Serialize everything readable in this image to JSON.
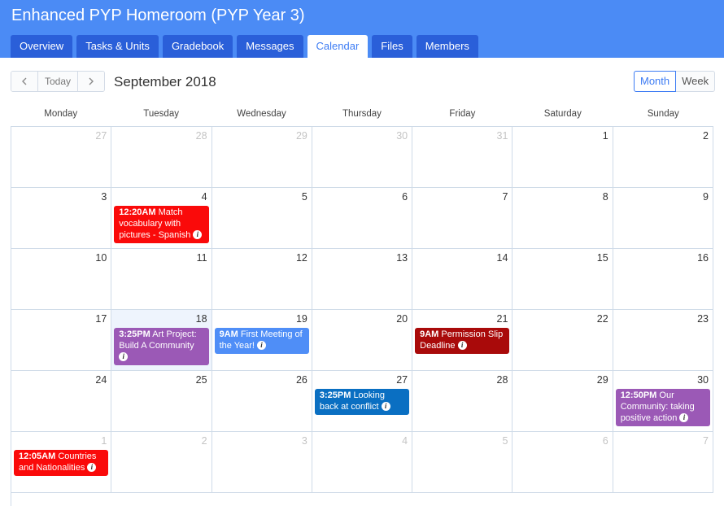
{
  "app": {
    "title": "Enhanced PYP Homeroom (PYP Year 3)"
  },
  "tabs": [
    {
      "label": "Overview",
      "active": false
    },
    {
      "label": "Tasks & Units",
      "active": false
    },
    {
      "label": "Gradebook",
      "active": false
    },
    {
      "label": "Messages",
      "active": false
    },
    {
      "label": "Calendar",
      "active": true
    },
    {
      "label": "Files",
      "active": false
    },
    {
      "label": "Members",
      "active": false
    }
  ],
  "toolbar": {
    "prev_icon": "chevron-left-icon",
    "today_label": "Today",
    "next_icon": "chevron-right-icon",
    "month_title": "September 2018",
    "view_month_label": "Month",
    "view_week_label": "Week"
  },
  "weekdays": [
    "Monday",
    "Tuesday",
    "Wednesday",
    "Thursday",
    "Friday",
    "Saturday",
    "Sunday"
  ],
  "colors": {
    "header_bg": "#4b8bf5",
    "tab_bg": "#2a5fd9",
    "today_bg": "#eef4fd",
    "event_red": "#fa0a0a",
    "event_purple": "#9b59b6",
    "event_lightblue": "#4f8ef7",
    "event_darkred": "#a90a0a",
    "event_blue": "#0a6fc2"
  },
  "weeks": [
    {
      "days": [
        {
          "date": "27",
          "other": true
        },
        {
          "date": "28",
          "other": true
        },
        {
          "date": "29",
          "other": true
        },
        {
          "date": "30",
          "other": true
        },
        {
          "date": "31",
          "other": true
        },
        {
          "date": "1"
        },
        {
          "date": "2"
        }
      ]
    },
    {
      "days": [
        {
          "date": "3"
        },
        {
          "date": "4",
          "event": {
            "time": "12:20AM",
            "title": "Match vocabulary with pictures - Spanish",
            "color": "#fa0a0a"
          }
        },
        {
          "date": "5"
        },
        {
          "date": "6"
        },
        {
          "date": "7"
        },
        {
          "date": "8"
        },
        {
          "date": "9"
        }
      ]
    },
    {
      "days": [
        {
          "date": "10"
        },
        {
          "date": "11"
        },
        {
          "date": "12"
        },
        {
          "date": "13"
        },
        {
          "date": "14"
        },
        {
          "date": "15"
        },
        {
          "date": "16"
        }
      ]
    },
    {
      "days": [
        {
          "date": "17"
        },
        {
          "date": "18",
          "today": true,
          "event": {
            "time": "3:25PM",
            "title": "Art Project: Build A Community",
            "color": "#9b59b6"
          }
        },
        {
          "date": "19",
          "event": {
            "time": "9AM",
            "title": "First Meeting of the Year!",
            "color": "#4f8ef7"
          }
        },
        {
          "date": "20"
        },
        {
          "date": "21",
          "event": {
            "time": "9AM",
            "title": "Permission Slip Deadline",
            "color": "#a90a0a"
          }
        },
        {
          "date": "22"
        },
        {
          "date": "23"
        }
      ]
    },
    {
      "days": [
        {
          "date": "24"
        },
        {
          "date": "25"
        },
        {
          "date": "26"
        },
        {
          "date": "27",
          "event": {
            "time": "3:25PM",
            "title": "Looking back at conflict",
            "color": "#0a6fc2"
          }
        },
        {
          "date": "28"
        },
        {
          "date": "29"
        },
        {
          "date": "30",
          "event": {
            "time": "12:50PM",
            "title": "Our Community: taking positive action",
            "color": "#9b59b6"
          }
        }
      ]
    },
    {
      "days": [
        {
          "date": "1",
          "other": true,
          "event": {
            "time": "12:05AM",
            "title": "Countries and Nationalities",
            "color": "#fa0a0a"
          }
        },
        {
          "date": "2",
          "other": true
        },
        {
          "date": "3",
          "other": true
        },
        {
          "date": "4",
          "other": true
        },
        {
          "date": "5",
          "other": true
        },
        {
          "date": "6",
          "other": true
        },
        {
          "date": "7",
          "other": true
        }
      ]
    }
  ]
}
